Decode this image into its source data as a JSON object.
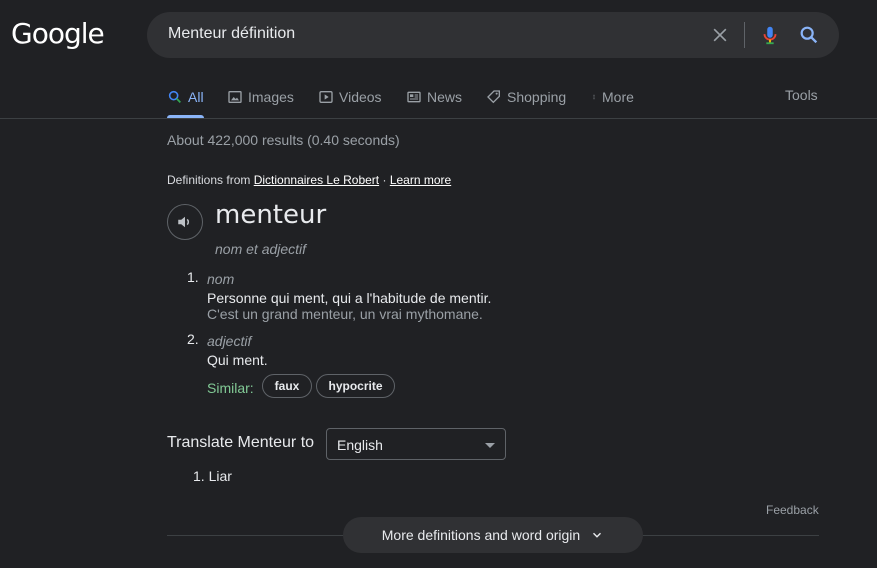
{
  "brand": {
    "logo_text": "Google"
  },
  "search": {
    "query": "Menteur définition"
  },
  "tabs": [
    {
      "label": "All",
      "icon": "search-icon"
    },
    {
      "label": "Images",
      "icon": "image-icon"
    },
    {
      "label": "Videos",
      "icon": "play-icon"
    },
    {
      "label": "News",
      "icon": "newspaper-icon"
    },
    {
      "label": "Shopping",
      "icon": "tag-icon"
    },
    {
      "label": "More",
      "icon": "kebab-icon"
    }
  ],
  "tools_label": "Tools",
  "result_stats": "About 422,000 results (0.40 seconds)",
  "definitions": {
    "from_prefix": "Definitions from",
    "source": "Dictionnaires Le Robert",
    "separator": "·",
    "learn_more": "Learn more",
    "word": "menteur",
    "part_of_speech": "nom et adjectif",
    "senses": [
      {
        "num": "1.",
        "pos": "nom",
        "definition": "Personne qui ment, qui a l'habitude de mentir.",
        "example": "C'est un grand menteur, un vrai mythomane."
      },
      {
        "num": "2.",
        "pos": "adjectif",
        "definition": "Qui ment."
      }
    ],
    "similar_label": "Similar:",
    "similar": [
      "faux",
      "hypocrite"
    ]
  },
  "translate": {
    "label": "Translate Menteur to",
    "language": "English",
    "results": [
      "1. Liar"
    ]
  },
  "feedback_label": "Feedback",
  "more_definitions_label": "More definitions and word origin",
  "colors": {
    "background": "#202124",
    "accent": "#8ab4f8",
    "similar_green": "#81c995"
  }
}
